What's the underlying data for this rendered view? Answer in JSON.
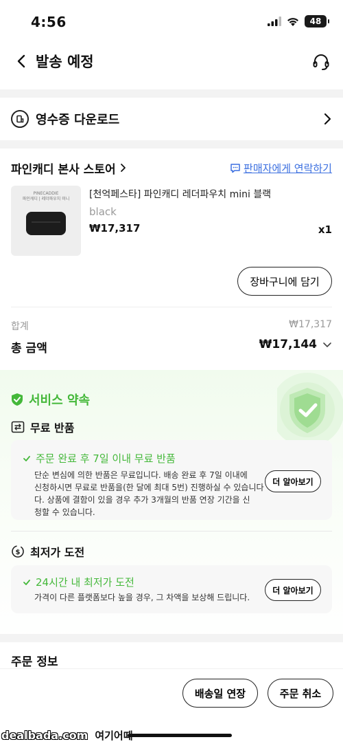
{
  "status_bar": {
    "time": "4:56",
    "battery": "48"
  },
  "header": {
    "title": "발송 예정"
  },
  "receipt": {
    "label": "영수증 다운로드"
  },
  "store": {
    "name": "파인캐디 본사 스토어",
    "contact_label": "판매자에게 연락하기"
  },
  "product": {
    "name": "[천억페스타] 파인캐디 레더파우치 mini 블랙",
    "option": "black",
    "price": "₩17,317",
    "quantity": "x1",
    "thumb_caption_1": "PINECADDIE",
    "thumb_caption_2": "파인캐디 | 레더파우치 미니"
  },
  "cart_button": "장바구니에 담기",
  "summary": {
    "subtotal_label": "합계",
    "subtotal_value": "₩17,317",
    "total_label": "총 금액",
    "total_value": "₩17,144"
  },
  "service": {
    "title": "서비스 약속",
    "free_return": {
      "heading": "무료 반품",
      "card_title": "주문 완료 후 7일 이내 무료 반품",
      "lines": [
        "단순 변심에 의한 반품은 무료입니다. 배송 완료 후 7일 이내에",
        "신청하시면 무료로 반품을(한 달에 최대 5번) 진행하실 수 있습니다",
        "다. 상품에 결함이 있을 경우 추가 3개월의 반품 연장 기간을 신",
        "청할 수 있습니다."
      ],
      "more_label": "더 알아보기"
    },
    "lowest_price": {
      "heading": "최저가 도전",
      "card_title": "24시간 내 최저가 도전",
      "line": "가격이 다른 플랫폼보다 높을 경우, 그 차액을 보상해 드립니다.",
      "more_label": "더 알아보기"
    }
  },
  "order_info": {
    "title": "주문 정보"
  },
  "bottom": {
    "extend_label": "배송일 연장",
    "cancel_label": "주문 취소",
    "watermark_site": "dealbada.com",
    "watermark_text": "여기어때"
  },
  "colors": {
    "accent_green": "#44b83a",
    "link_blue": "#3b6fe0"
  }
}
